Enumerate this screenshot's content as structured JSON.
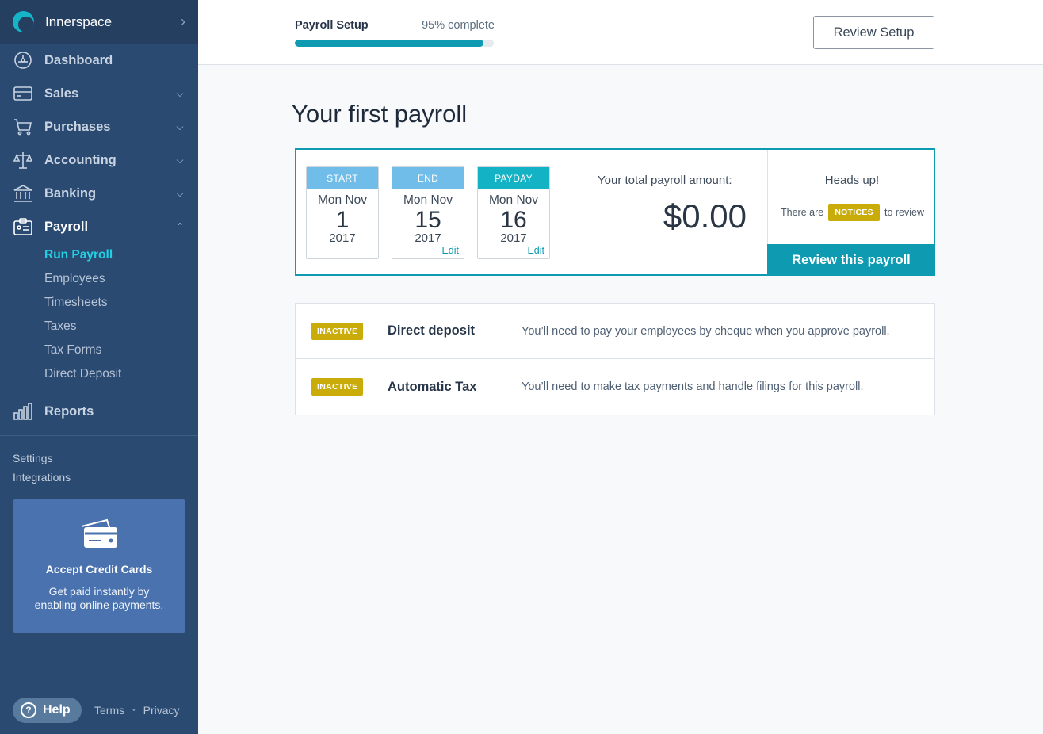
{
  "brand": {
    "name": "Innerspace"
  },
  "nav": {
    "dashboard": "Dashboard",
    "sales": "Sales",
    "purchases": "Purchases",
    "accounting": "Accounting",
    "banking": "Banking",
    "payroll": "Payroll",
    "reports": "Reports"
  },
  "payroll_subnav": [
    "Run Payroll",
    "Employees",
    "Timesheets",
    "Taxes",
    "Tax Forms",
    "Direct Deposit"
  ],
  "side_links": {
    "settings": "Settings",
    "integrations": "Integrations"
  },
  "promo": {
    "title": "Accept Credit Cards",
    "line1": "Get paid instantly by",
    "line2": "enabling online payments."
  },
  "footer": {
    "help": "Help",
    "terms": "Terms",
    "dot": "•",
    "privacy": "Privacy"
  },
  "topbar": {
    "progress_title": "Payroll Setup",
    "progress_pct": "95% complete",
    "progress_fraction": 0.95,
    "review_setup": "Review Setup"
  },
  "page_title": "Your first payroll",
  "dates": {
    "start": {
      "label": "START",
      "dow": "Mon Nov",
      "day": "1",
      "year": "2017",
      "color": "#6fbde8"
    },
    "end": {
      "label": "END",
      "dow": "Mon Nov",
      "day": "15",
      "year": "2017",
      "edit": "Edit",
      "color": "#6fbde8"
    },
    "payday": {
      "label": "PAYDAY",
      "dow": "Mon Nov",
      "day": "16",
      "year": "2017",
      "edit": "Edit",
      "color": "#13b2c4"
    }
  },
  "total": {
    "label": "Your total payroll amount:",
    "amount": "$0.00"
  },
  "notice": {
    "heading": "Heads up!",
    "prefix": "There are",
    "badge": "NOTICES",
    "suffix": "to review"
  },
  "review_payroll": "Review this payroll",
  "services": [
    {
      "status": "INACTIVE",
      "name": "Direct deposit",
      "desc": "You’ll need to pay your employees by cheque when you approve payroll."
    },
    {
      "status": "INACTIVE",
      "name": "Automatic Tax",
      "desc": "You’ll need to make tax payments and handle filings for this payroll."
    }
  ],
  "colors": {
    "sidebar": "#2b4a72",
    "accent": "#0e9bb2",
    "badge": "#c9ab0a",
    "active_sub": "#22d0e4"
  }
}
